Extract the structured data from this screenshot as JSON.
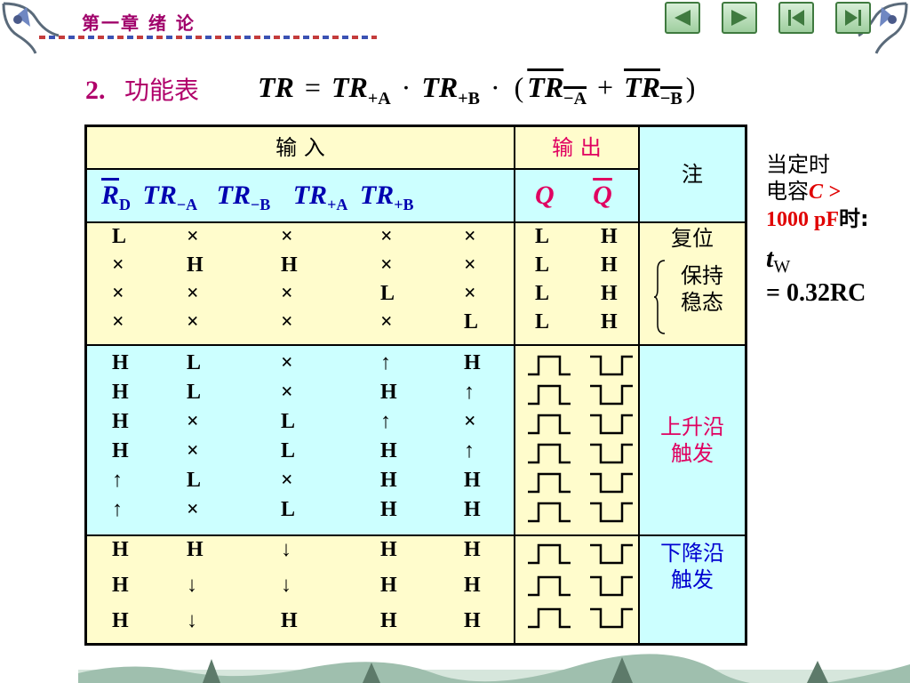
{
  "header": {
    "chapter": "第一章 绪    论",
    "nav": [
      "previous-page",
      "next-page",
      "first-page",
      "last-page"
    ]
  },
  "title": {
    "number": "2.",
    "label": "功能表",
    "formula": {
      "lhs": "TR",
      "eq": "=",
      "t1": "TR",
      "t1_sub": "+A",
      "dot1": "·",
      "t2": "TR",
      "t2_sub": "+B",
      "dot2": "·",
      "open": "(",
      "t3": "TR",
      "t3_sub": "−A",
      "plus": "+",
      "t4": "TR",
      "t4_sub": "−B",
      "close": ")"
    }
  },
  "table": {
    "header_input": "输    入",
    "header_output": "输   出",
    "header_note": "注",
    "sub_inputs": {
      "rd": "R",
      "rd_sub": "D",
      "a": "TR",
      "a_sub": "−A",
      "b": "TR",
      "b_sub": "−B",
      "c": "TR",
      "c_sub": "+A",
      "d": "TR",
      "d_sub": "+B"
    },
    "sub_outputs": {
      "q": "Q",
      "qbar": "Q"
    },
    "group1": {
      "rows": [
        [
          "L",
          "×",
          "×",
          "×",
          "×",
          "L",
          "H"
        ],
        [
          "×",
          "H",
          "H",
          "×",
          "×",
          "L",
          "H"
        ],
        [
          "×",
          "×",
          "×",
          "L",
          "×",
          "L",
          "H"
        ],
        [
          "×",
          "×",
          "×",
          "×",
          "L",
          "L",
          "H"
        ]
      ],
      "note1": "复位",
      "note2": "保持",
      "note3": "稳态"
    },
    "group2": {
      "rows": [
        [
          "H",
          "L",
          "×",
          "↑",
          "H"
        ],
        [
          "H",
          "L",
          "×",
          "H",
          "↑"
        ],
        [
          "H",
          "×",
          "L",
          "↑",
          "×"
        ],
        [
          "H",
          "×",
          "L",
          "H",
          "↑"
        ],
        [
          "↑",
          "L",
          "×",
          "H",
          "H"
        ],
        [
          "↑",
          "×",
          "L",
          "H",
          "H"
        ]
      ],
      "note1": "上升沿",
      "note2": "触发"
    },
    "group3": {
      "rows": [
        [
          "H",
          "H",
          "↓",
          "H",
          "H"
        ],
        [
          "H",
          "↓",
          "↓",
          "H",
          "H"
        ],
        [
          "H",
          "↓",
          "H",
          "H",
          "H"
        ]
      ],
      "note1": "下降沿",
      "note2": "触发"
    }
  },
  "side_note": {
    "line1": "当定时",
    "line2a": "电容",
    "line2b": "C >",
    "line3a": "1000 pF",
    "line3b": "时:",
    "tw": "t",
    "tw_sub": "W",
    "result": "= 0.32RC"
  },
  "colors": {
    "accent": "#b0006a",
    "yellow": "#fffccc",
    "cyan": "#ccffff",
    "red": "#e00060",
    "blue": "#0000d0"
  }
}
